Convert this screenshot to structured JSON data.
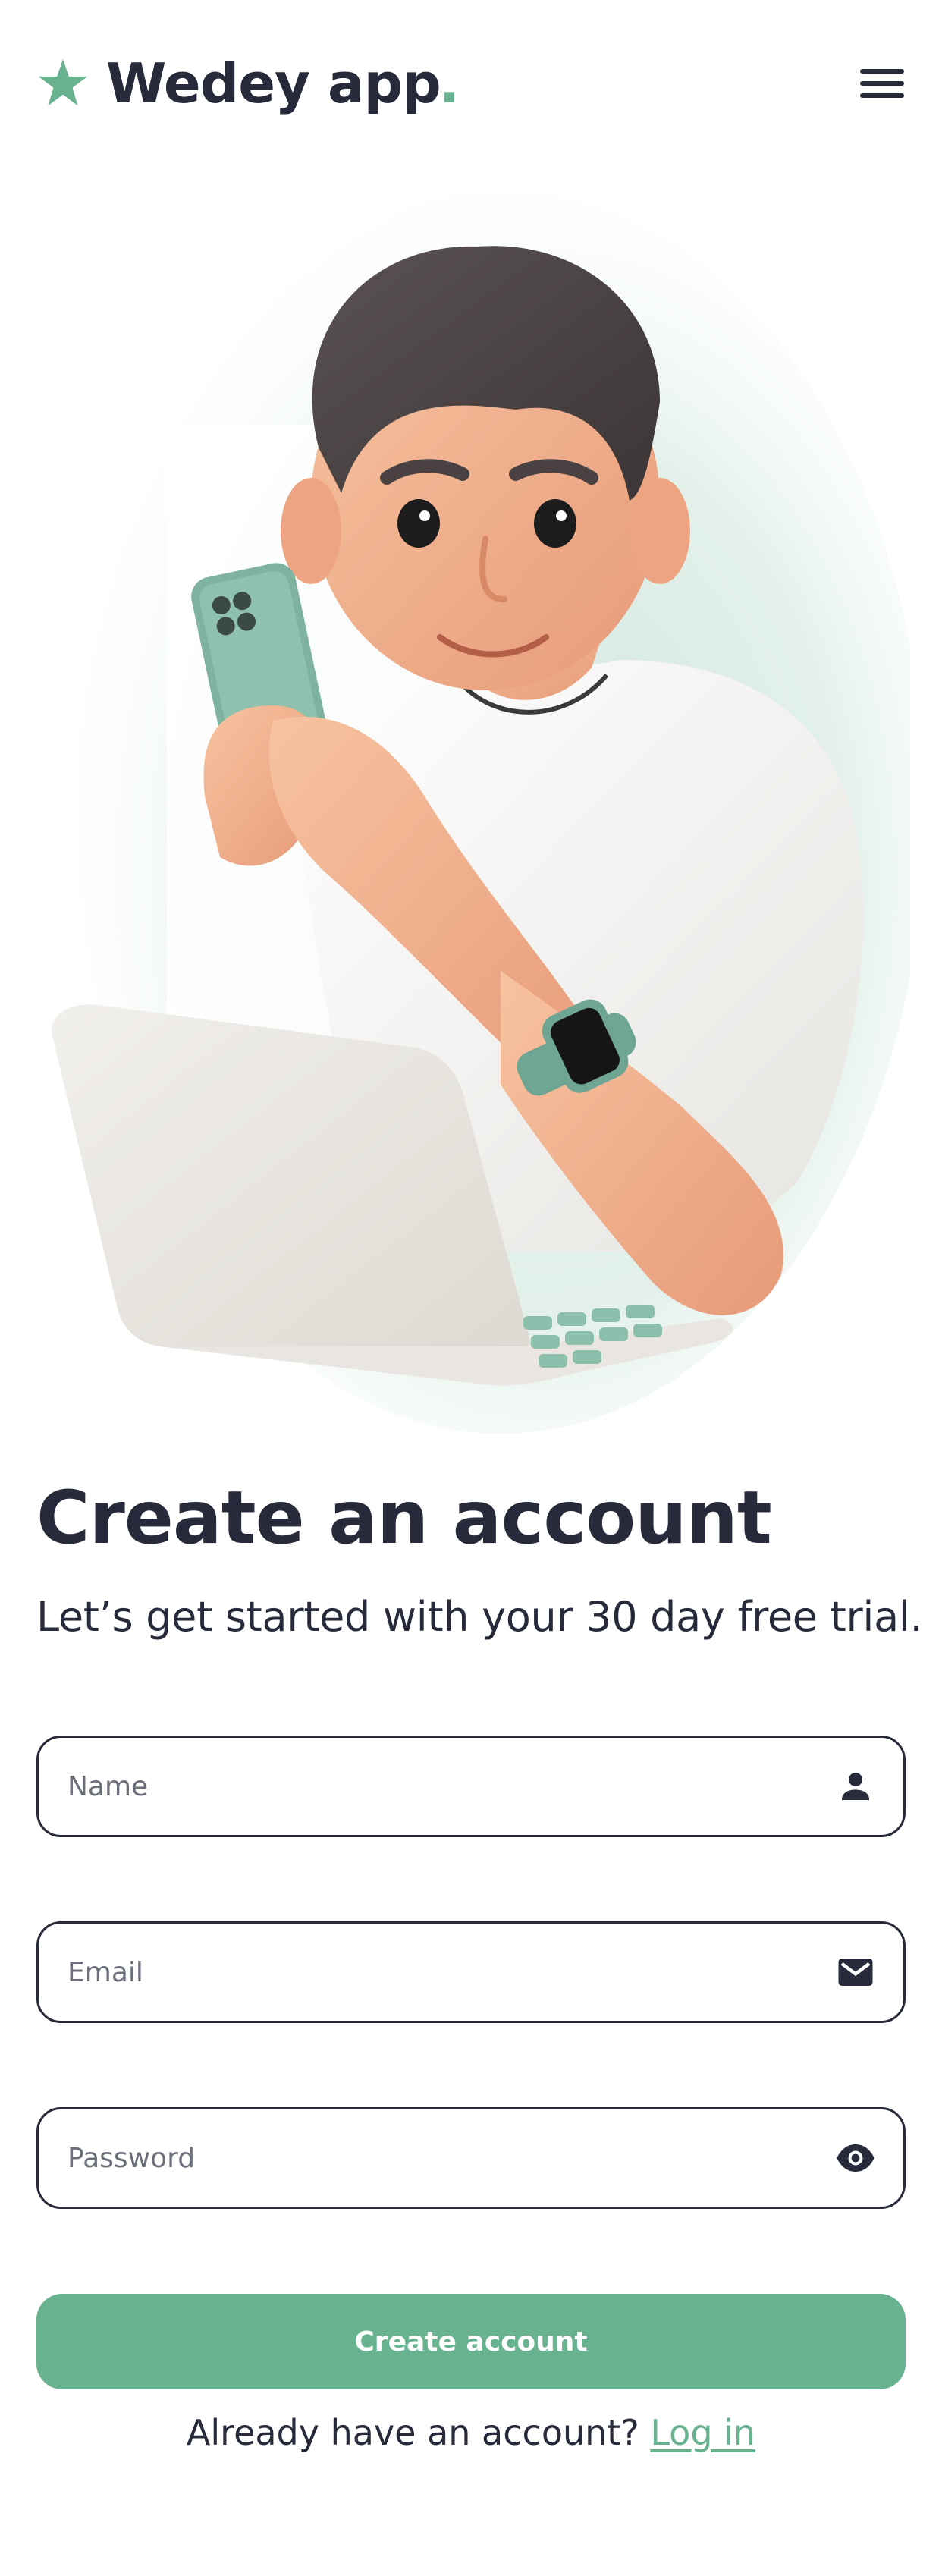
{
  "header": {
    "brand_name": "Wedey app",
    "brand_dot": ".",
    "brand_icon": "star-icon",
    "menu_icon": "hamburger-menu-icon"
  },
  "hero": {
    "illustration": "person-with-phone-and-laptop-illustration"
  },
  "main": {
    "title": "Create an account",
    "subtitle": "Let’s get started with your 30 day free trial."
  },
  "form": {
    "name": {
      "placeholder": "Name",
      "value": "",
      "icon": "user-icon"
    },
    "email": {
      "placeholder": "Email",
      "value": "",
      "icon": "mail-icon"
    },
    "password": {
      "placeholder": "Password",
      "value": "",
      "icon": "eye-icon"
    },
    "submit_label": "Create account"
  },
  "footer": {
    "prompt": "Already have an account?",
    "login_link": "Log in"
  },
  "colors": {
    "accent": "#68b28f",
    "text": "#262a3a",
    "background": "#ffffff"
  }
}
